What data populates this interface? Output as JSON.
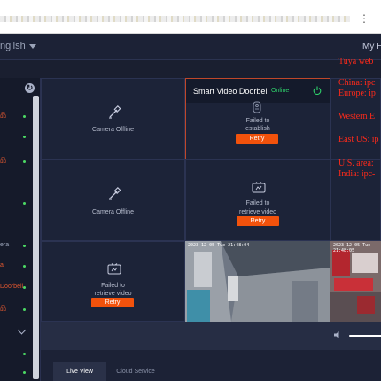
{
  "header": {
    "language": "nglish",
    "user": "My H"
  },
  "sidebar": {
    "items": [
      {
        "label": "品",
        "style": "red",
        "online": true
      },
      {
        "label": "",
        "style": "red",
        "online": true
      },
      {
        "label": "品",
        "style": "red",
        "online": true
      },
      {
        "label": "",
        "style": "red",
        "online": false
      },
      {
        "label": "",
        "style": "red",
        "online": true
      },
      {
        "label": "era",
        "style": "grey",
        "online": true
      },
      {
        "label": "a",
        "style": "red",
        "online": true
      },
      {
        "label": "Doorbell",
        "style": "red",
        "online": true
      },
      {
        "label": "品",
        "style": "red",
        "online": true
      },
      {
        "label": "",
        "style": "grey",
        "online": false
      },
      {
        "label": "",
        "style": "red",
        "online": true
      },
      {
        "label": "",
        "style": "red",
        "online": true
      }
    ]
  },
  "cells": {
    "cam1": {
      "message": "Camera Offline"
    },
    "doorbell": {
      "title": "Smart Video Doorbell",
      "status": "Online",
      "message_line1": "Failed to",
      "message_line2": "establish",
      "retry": "Retry"
    },
    "cam2": {
      "message": "Camera Offline"
    },
    "cam3": {
      "message_line1": "Failed to",
      "message_line2": "retrieve video",
      "retry": "Retry"
    },
    "cam4": {
      "message_line1": "Failed to",
      "message_line2": "retrieve video",
      "retry": "Retry"
    },
    "video1": {
      "timestamp": "2023-12-05 Tue 21:48:04"
    },
    "video2": {
      "timestamp": "2023-12-05 Tue 21:48:05"
    }
  },
  "notes": {
    "line1": "Tuya web",
    "line2": "China: ipc",
    "line3": "Europe: ip",
    "line4": "Western E",
    "line5": "East US: ip",
    "line6": "U.S. area:",
    "line7": "India: ipc-"
  },
  "tabs": {
    "live": "Live View",
    "cloud": "Cloud Service"
  },
  "colors": {
    "accent": "#f2520c",
    "online": "#2fd16b",
    "background": "#1a1f30",
    "note_red": "#ff2a1a"
  }
}
